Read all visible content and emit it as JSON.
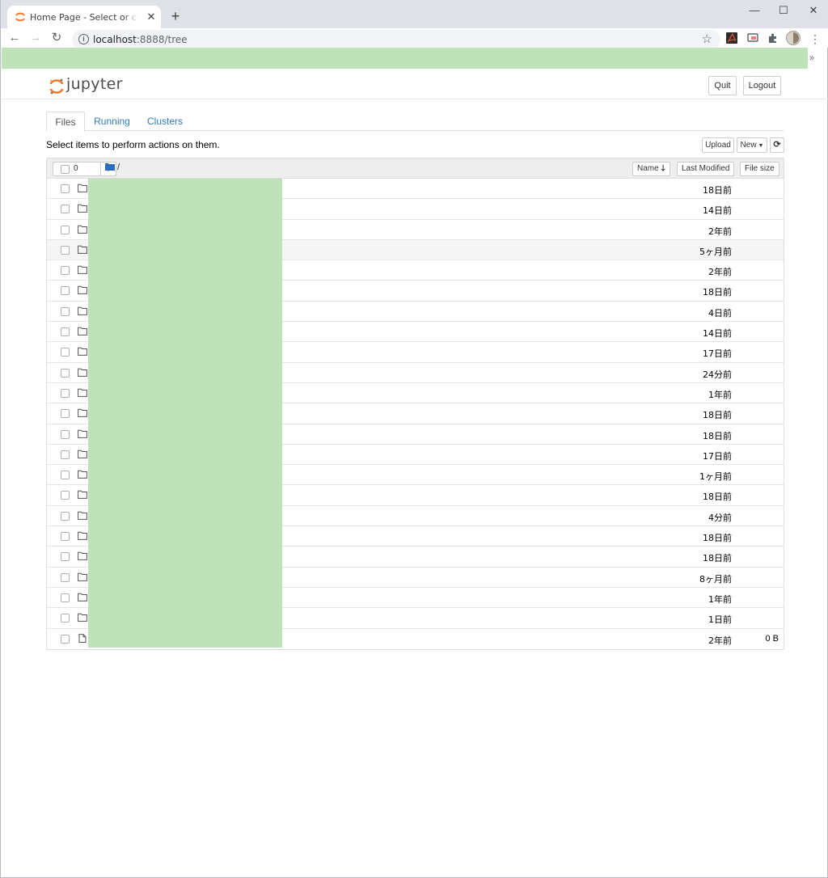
{
  "browser": {
    "tab_title": "Home Page - Select or create a notebook",
    "url_host": "localhost",
    "url_rest": ":8888/tree"
  },
  "header": {
    "logo_text": "jupyter",
    "quit_label": "Quit",
    "logout_label": "Logout"
  },
  "tabs": [
    {
      "label": "Files"
    },
    {
      "label": "Running"
    },
    {
      "label": "Clusters"
    }
  ],
  "hint": "Select items to perform actions on them.",
  "actions": {
    "upload_label": "Upload",
    "new_label": "New"
  },
  "list_header": {
    "selected_count": "0",
    "breadcrumb": "/",
    "sort_name": "Name",
    "sort_modified": "Last Modified",
    "sort_size": "File size"
  },
  "rows": [
    {
      "type": "folder",
      "modified": "18日前",
      "size": ""
    },
    {
      "type": "folder",
      "modified": "14日前",
      "size": ""
    },
    {
      "type": "folder",
      "modified": "2年前",
      "size": ""
    },
    {
      "type": "folder",
      "modified": "5ヶ月前",
      "size": ""
    },
    {
      "type": "folder",
      "modified": "2年前",
      "size": ""
    },
    {
      "type": "folder",
      "modified": "18日前",
      "size": ""
    },
    {
      "type": "folder",
      "modified": "4日前",
      "size": ""
    },
    {
      "type": "folder",
      "modified": "14日前",
      "size": ""
    },
    {
      "type": "folder",
      "modified": "17日前",
      "size": ""
    },
    {
      "type": "folder",
      "modified": "24分前",
      "size": ""
    },
    {
      "type": "folder",
      "modified": "1年前",
      "size": ""
    },
    {
      "type": "folder",
      "modified": "18日前",
      "size": ""
    },
    {
      "type": "folder",
      "modified": "18日前",
      "size": ""
    },
    {
      "type": "folder",
      "modified": "17日前",
      "size": ""
    },
    {
      "type": "folder",
      "modified": "1ヶ月前",
      "size": ""
    },
    {
      "type": "folder",
      "modified": "18日前",
      "size": ""
    },
    {
      "type": "folder",
      "modified": "4分前",
      "size": ""
    },
    {
      "type": "folder",
      "modified": "18日前",
      "size": ""
    },
    {
      "type": "folder",
      "modified": "18日前",
      "size": ""
    },
    {
      "type": "folder",
      "modified": "8ヶ月前",
      "size": ""
    },
    {
      "type": "folder",
      "modified": "1年前",
      "size": ""
    },
    {
      "type": "folder",
      "modified": "1日前",
      "size": ""
    },
    {
      "type": "file",
      "modified": "2年前",
      "size": "0 B"
    }
  ],
  "colors": {
    "redaction": "#bfe3b9",
    "link": "#337ab7",
    "jupyter_orange": "#f37726"
  }
}
